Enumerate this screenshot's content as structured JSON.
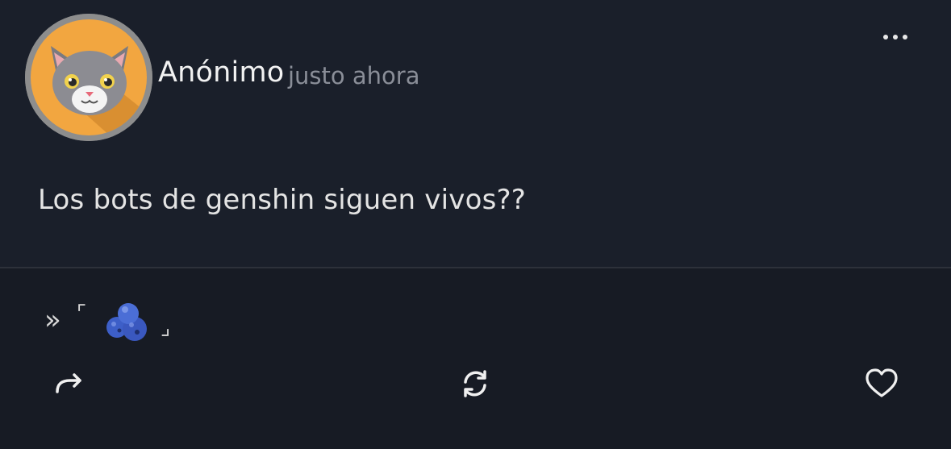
{
  "post": {
    "author": "Anónimo",
    "time": "justo ahora",
    "content": "Los bots de genshin siguen vivos??",
    "avatar_icon": "cat-face-icon",
    "more_icon": "more-options-icon"
  },
  "signature": {
    "arrows": "»",
    "bracket_open": "⌜",
    "emoji": "blueberries-icon",
    "bracket_close": "⌟"
  },
  "actions": {
    "share_icon": "share-arrow-icon",
    "repost_icon": "repost-icon",
    "like_icon": "heart-icon"
  },
  "colors": {
    "background": "#1a1f2a",
    "footer": "#171b24",
    "avatar_bg": "#f0a53f"
  }
}
